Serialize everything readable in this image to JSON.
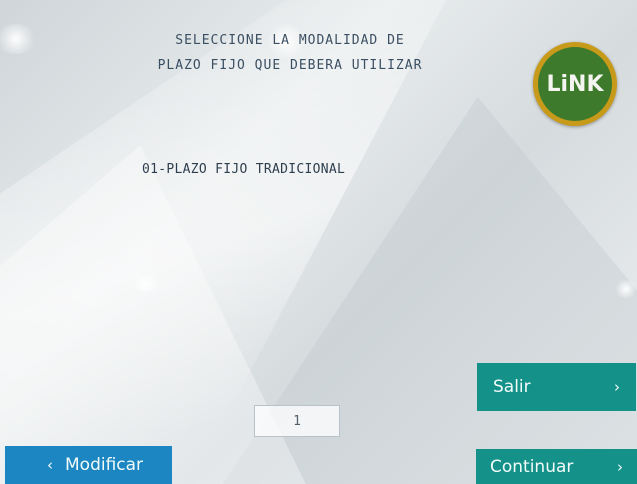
{
  "screen": {
    "title_line_1": "SELECCIONE LA MODALIDAD DE",
    "title_line_2": "PLAZO FIJO QUE DEBERA UTILIZAR",
    "logo_text": "LiNK",
    "options": [
      {
        "label": "01-PLAZO FIJO TRADICIONAL"
      }
    ],
    "page_number": "1"
  },
  "buttons": {
    "salir": {
      "label": "Salir",
      "icon": "chevron-right-icon",
      "glyph": "›"
    },
    "continuar": {
      "label": "Continuar",
      "icon": "chevron-right-icon",
      "glyph": "›"
    },
    "modificar": {
      "label": "Modificar",
      "icon": "chevron-left-icon",
      "glyph": "‹"
    }
  },
  "colors": {
    "primary_button": "#14928a",
    "secondary_button": "#1b86c1",
    "text": "#3b4f63",
    "logo_ring": "#c89a1a",
    "logo_fill": "#3e7a2c"
  }
}
